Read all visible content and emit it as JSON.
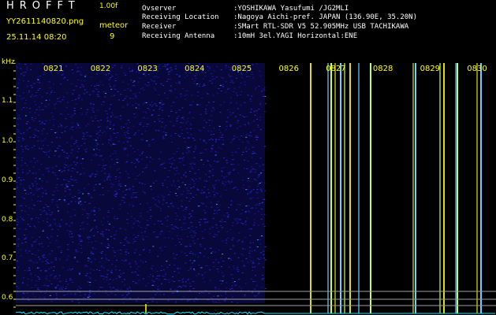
{
  "header": {
    "app_title": "HROFFT",
    "version": "1.00f",
    "filename": "YY2611140820.png",
    "datetime": "25.11.14 08:20",
    "meteor_label": "meteor",
    "meteor_count": "9"
  },
  "info": {
    "observer_key": "Ovserver",
    "observer_val": ":YOSHIKAWA Yasufumi /JG2MLI",
    "location_key": "Receiving Location",
    "location_val": ":Nagoya Aichi-pref. JAPAN (136.90E, 35.20N)",
    "receiver_key": "Receiver",
    "receiver_val": ":SMart RTL-SDR V5 52.905MHz USB TACHIKAWA",
    "antenna_key": "Receiving Antenna",
    "antenna_val": ":10mH 3el.YAGI Horizontal:ENE"
  },
  "spectrogram": {
    "y_unit": "kHz",
    "y_ticks": [
      "1.1",
      "1.0",
      "0.9",
      "0.8",
      "0.7",
      "0.6"
    ],
    "x_ticks": [
      "0821",
      "0822",
      "0823",
      "0824",
      "0825",
      "0826",
      "0827",
      "0828",
      "0829",
      "0830"
    ],
    "noise_color": "#1a1aa0",
    "background_color": "#000000",
    "label_color": "#ffff00",
    "trace_color": "#00e5ff"
  }
}
